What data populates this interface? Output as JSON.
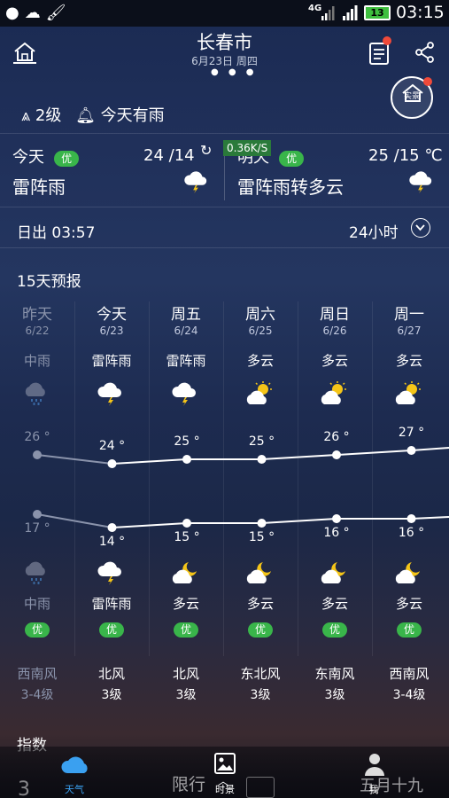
{
  "status_bar": {
    "network": "4G",
    "battery": "13",
    "time": "03:15"
  },
  "header": {
    "city": "长春市",
    "date": "6月23日 周四"
  },
  "current": {
    "wind": "2级",
    "notice": "今天有雨"
  },
  "live_btn_label": "实景",
  "net_speed": "0.36K/S",
  "today": {
    "label": "今天",
    "aqi": "优",
    "range": "24 /14",
    "condition": "雷阵雨"
  },
  "tomorrow": {
    "label": "明天",
    "aqi": "优",
    "range": "25 /15 ℃",
    "condition": "雷阵雨转多云"
  },
  "sunrise": "日出 03:57",
  "hours_label": "24小时",
  "forecast_title": "15天预报",
  "forecast": [
    {
      "day": "昨天",
      "date": "6/22",
      "day_cond": "中雨",
      "high": "26 °",
      "low": "17 °",
      "night_cond": "中雨",
      "aqi": "优",
      "wind_dir": "西南风",
      "wind_lvl": "3-4级",
      "day_icon": "rain-cloud-icon",
      "night_icon": "rain-cloud-icon",
      "high_val": 26,
      "low_val": 17
    },
    {
      "day": "今天",
      "date": "6/23",
      "day_cond": "雷阵雨",
      "high": "24 °",
      "low": "14 °",
      "night_cond": "雷阵雨",
      "aqi": "优",
      "wind_dir": "北风",
      "wind_lvl": "3级",
      "day_icon": "thunder-cloud-icon",
      "night_icon": "thunder-cloud-icon",
      "high_val": 24,
      "low_val": 14
    },
    {
      "day": "周五",
      "date": "6/24",
      "day_cond": "雷阵雨",
      "high": "25 °",
      "low": "15 °",
      "night_cond": "多云",
      "aqi": "优",
      "wind_dir": "北风",
      "wind_lvl": "3级",
      "day_icon": "thunder-cloud-icon",
      "night_icon": "moon-cloud-icon",
      "high_val": 25,
      "low_val": 15
    },
    {
      "day": "周六",
      "date": "6/25",
      "day_cond": "多云",
      "high": "25 °",
      "low": "15 °",
      "night_cond": "多云",
      "aqi": "优",
      "wind_dir": "东北风",
      "wind_lvl": "3级",
      "day_icon": "sun-cloud-icon",
      "night_icon": "moon-cloud-icon",
      "high_val": 25,
      "low_val": 15
    },
    {
      "day": "周日",
      "date": "6/26",
      "day_cond": "多云",
      "high": "26 °",
      "low": "16 °",
      "night_cond": "多云",
      "aqi": "优",
      "wind_dir": "东南风",
      "wind_lvl": "3级",
      "day_icon": "sun-cloud-icon",
      "night_icon": "moon-cloud-icon",
      "high_val": 26,
      "low_val": 16
    },
    {
      "day": "周一",
      "date": "6/27",
      "day_cond": "多云",
      "high": "27 °",
      "low": "16 °",
      "night_cond": "多云",
      "aqi": "优",
      "wind_dir": "西南风",
      "wind_lvl": "3-4级",
      "day_icon": "sun-cloud-icon",
      "night_icon": "moon-cloud-icon",
      "high_val": 27,
      "low_val": 16
    }
  ],
  "index_title": "指数",
  "bottom_ghost": {
    "left": "3",
    "middle": "限行",
    "right": "五月十九"
  },
  "nav": [
    {
      "label": "天气",
      "icon": "cloud-icon",
      "active": true
    },
    {
      "label": "时景",
      "icon": "photo-icon",
      "active": false
    },
    {
      "label": "我",
      "icon": "person-icon",
      "active": false
    }
  ],
  "colors": {
    "aqi_green": "#39b54a",
    "accent_blue": "#3aa0f0",
    "badge_red": "#f04a3a"
  }
}
